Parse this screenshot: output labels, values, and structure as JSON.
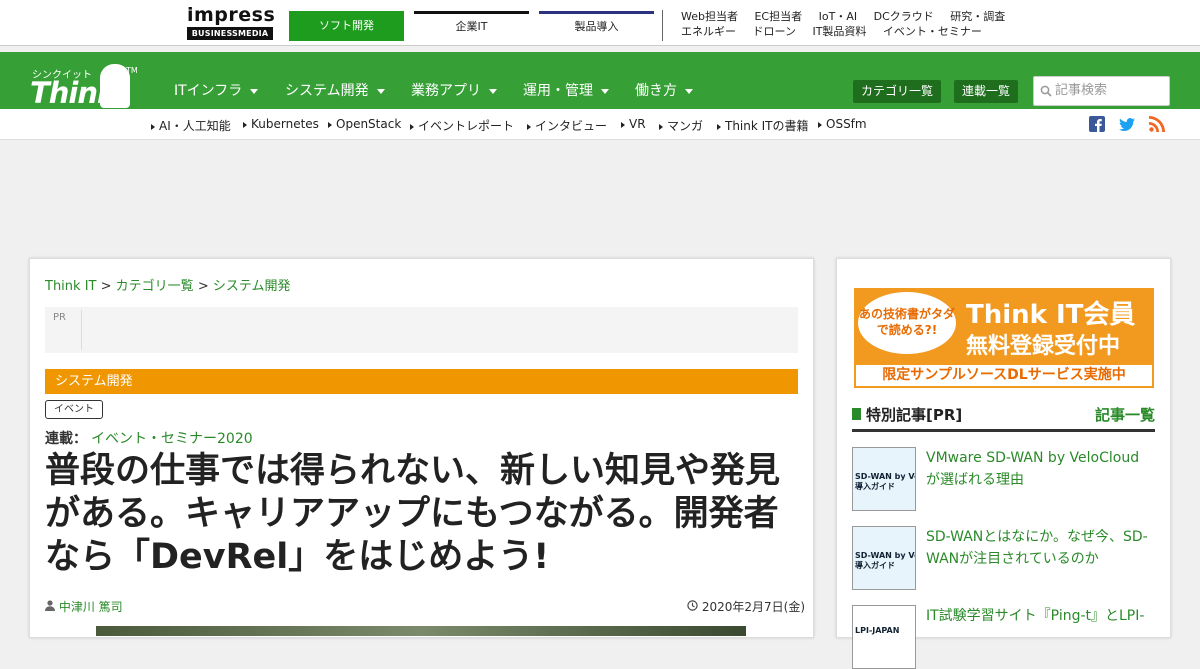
{
  "topbar": {
    "logo_line1": "impress",
    "logo_line2": "BUSINESSMEDIA",
    "tabs": [
      {
        "label": "ソフト開発"
      },
      {
        "label": "企業IT"
      },
      {
        "label": "製品導入"
      }
    ],
    "links_row1": [
      "Web担当者",
      "EC担当者",
      "IoT・AI",
      "DCクラウド",
      "研究・調査"
    ],
    "links_row2": [
      "エネルギー",
      "ドローン",
      "IT製品資料",
      "イベント・セミナー"
    ]
  },
  "brand": {
    "kana": "シンクイット",
    "name": "Think IT",
    "tm": "TM"
  },
  "nav": {
    "items": [
      {
        "label": "ITインフラ"
      },
      {
        "label": "システム開発"
      },
      {
        "label": "業務アプリ"
      },
      {
        "label": "運用・管理"
      },
      {
        "label": "働き方"
      }
    ],
    "category_button": "カテゴリ一覧",
    "series_button": "連載一覧",
    "search_placeholder": "記事検索"
  },
  "subnav": {
    "items": [
      "AI・人工知能",
      "Kubernetes",
      "OpenStack",
      "イベントレポート",
      "インタビュー",
      "VR",
      "マンガ",
      "Think ITの書籍",
      "OSSfm"
    ]
  },
  "colors": {
    "brand_green": "#36a036",
    "category_orange": "#ef9600",
    "link_green": "#2a8a2a"
  },
  "article": {
    "breadcrumb": {
      "home": "Think IT",
      "sep": ">",
      "level1": "カテゴリ一覧",
      "level2": "システム開発"
    },
    "pr_label": "PR",
    "category": "システム開発",
    "tag": "イベント",
    "series_label": "連載：",
    "series_name": "イベント・セミナー2020",
    "title": "普段の仕事では得られない、新しい知見や発見がある。キャリアアップにもつながる。開発者なら「DevRel」をはじめよう!",
    "author": "中津川 篤司",
    "date": "2020年2月7日(金)"
  },
  "sidebar": {
    "banner": {
      "bubble": "あの技術書がタダで読める?!",
      "line1": "Think IT会員",
      "line2": "無料登録受付中",
      "strip": "限定サンプルソースDLサービス実施中"
    },
    "special_title": "特別記事[PR]",
    "special_more": "記事一覧",
    "items": [
      {
        "thumb": "SD-WAN by Ve\n導入ガイド",
        "title": "VMware SD-WAN by VeloCloudが選ばれる理由"
      },
      {
        "thumb": "SD-WAN by Ve\n導入ガイド",
        "title": "SD-WANとはなにか。なぜ今、SD-WANが注目されているのか"
      },
      {
        "thumb": "LPI-JAPAN",
        "title": "IT試験学習サイト『Ping-t』とLPI-"
      }
    ]
  }
}
